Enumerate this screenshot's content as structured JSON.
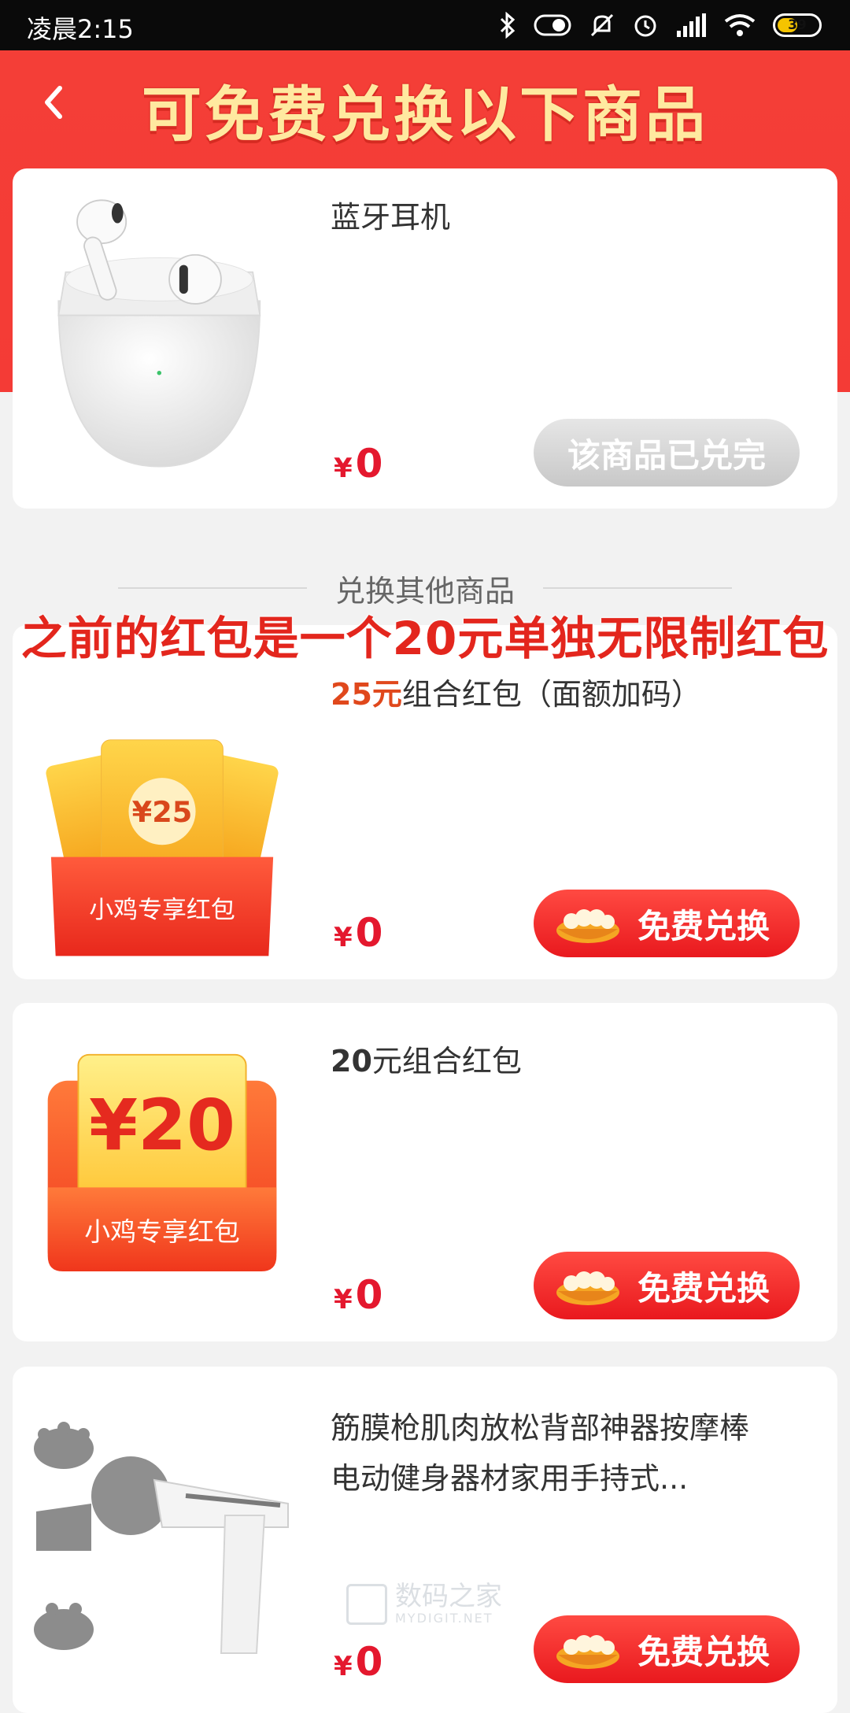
{
  "status_bar": {
    "time": "凌晨2:15",
    "battery": "39"
  },
  "header": {
    "title": "可免费兑换以下商品"
  },
  "featured": {
    "name": "蓝牙耳机",
    "currency": "¥",
    "price": "0",
    "button": "该商品已兑完"
  },
  "section": {
    "title": "兑换其他商品"
  },
  "overlay_note": "之前的红包是一个20元单独无限制红包",
  "items": [
    {
      "name_highlight": "25元",
      "name_rest": "组合红包（面额加码）",
      "badge_amount": "¥25",
      "badge_label": "小鸡专享红包",
      "currency": "¥",
      "price": "0",
      "button": "免费兑换"
    },
    {
      "name_bold": "20",
      "name_rest": "元组合红包",
      "badge_amount": "¥20",
      "badge_label": "小鸡专享红包",
      "currency": "¥",
      "price": "0",
      "button": "免费兑换"
    },
    {
      "name": "筋膜枪肌肉放松背部神器按摩棒电动健身器材家用手持式...",
      "currency": "¥",
      "price": "0",
      "button": "免费兑换"
    }
  ],
  "watermark": {
    "line1": "数码之家",
    "line2": "MYDIGIT.NET"
  },
  "colors": {
    "header_red": "#f43e37",
    "price_red": "#e4182e",
    "title_yellow": "#ffe9a0",
    "highlight_orange": "#e0481c"
  }
}
